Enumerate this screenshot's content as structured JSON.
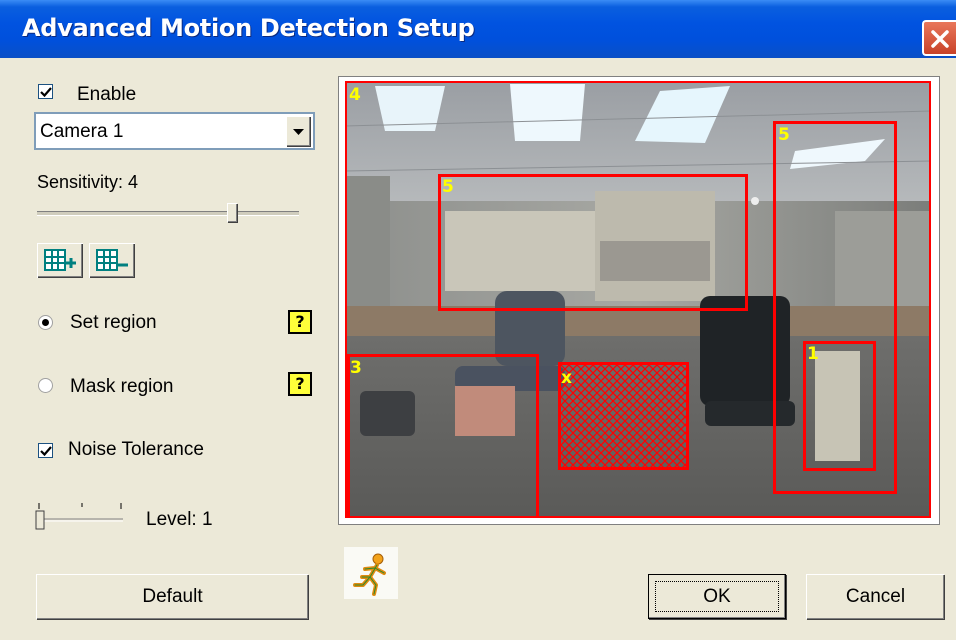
{
  "window": {
    "title": "Advanced Motion Detection Setup"
  },
  "enable": {
    "label": "Enable",
    "checked": true
  },
  "camera_select": {
    "value": "Camera 1"
  },
  "sensitivity": {
    "label": "Sensitivity: 4",
    "value": 4
  },
  "region_mode": {
    "set_label": "Set region",
    "mask_label": "Mask region",
    "selected": "set"
  },
  "noise_tolerance": {
    "label": "Noise Tolerance",
    "checked": true
  },
  "level": {
    "label": "Level: 1",
    "value": 1
  },
  "buttons": {
    "default": "Default",
    "ok": "OK",
    "cancel": "Cancel"
  },
  "regions": [
    {
      "number": "4",
      "type": "detect"
    },
    {
      "number": "5",
      "type": "detect"
    },
    {
      "number": "5",
      "type": "detect"
    },
    {
      "number": "3",
      "type": "detect"
    },
    {
      "number": "x",
      "type": "mask"
    },
    {
      "number": "1",
      "type": "detect"
    }
  ],
  "colors": {
    "region_border": "#ff0000",
    "region_label": "#ffff00",
    "title_bar": "#0153e0"
  },
  "icons": {
    "add_region": "grid-plus-icon",
    "remove_region": "grid-minus-icon",
    "help": "help-icon",
    "motion": "running-man-icon"
  }
}
